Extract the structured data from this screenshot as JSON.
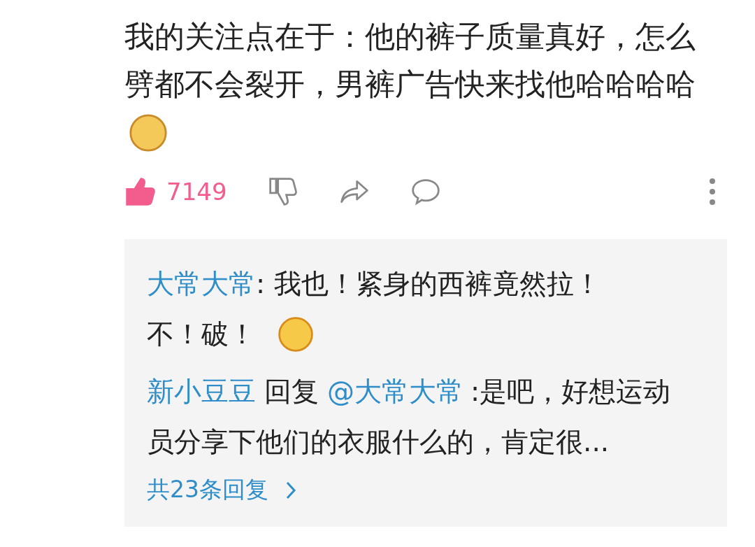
{
  "comment": {
    "text": "我的关注点在于：他的裤子质量真好，怎么劈都不会裂开，男裤广告快来找他哈哈哈哈",
    "likes": "7149",
    "liked": true
  },
  "replies": [
    {
      "name": "大常大常",
      "text": ": 我也！紧身的西裤竟然拉！",
      "continuation": "不！破！"
    },
    {
      "name": "新小豆豆",
      "verb": "回复",
      "reply_to": "@大常大常",
      "text": ":是吧，好想运动员分享下他们的衣服什么的，肯定很..."
    }
  ],
  "more_replies": "共23条回复"
}
